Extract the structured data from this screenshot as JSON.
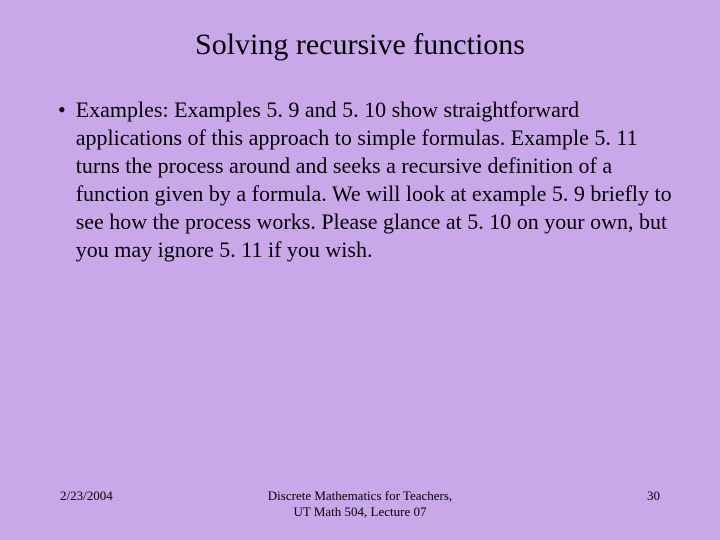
{
  "slide": {
    "title": "Solving recursive functions",
    "bullet": "•",
    "body": "Examples: Examples 5. 9 and 5. 10 show straightforward applications of this approach to simple formulas. Example 5. 11 turns the process around and seeks a recursive definition of a function given by a formula. We will look at example 5. 9 briefly to see how the process works. Please glance at 5. 10 on your own, but you may ignore 5. 11 if you wish."
  },
  "footer": {
    "date": "2/23/2004",
    "center_line1": "Discrete Mathematics for Teachers,",
    "center_line2": "UT Math 504, Lecture 07",
    "page": "30"
  }
}
